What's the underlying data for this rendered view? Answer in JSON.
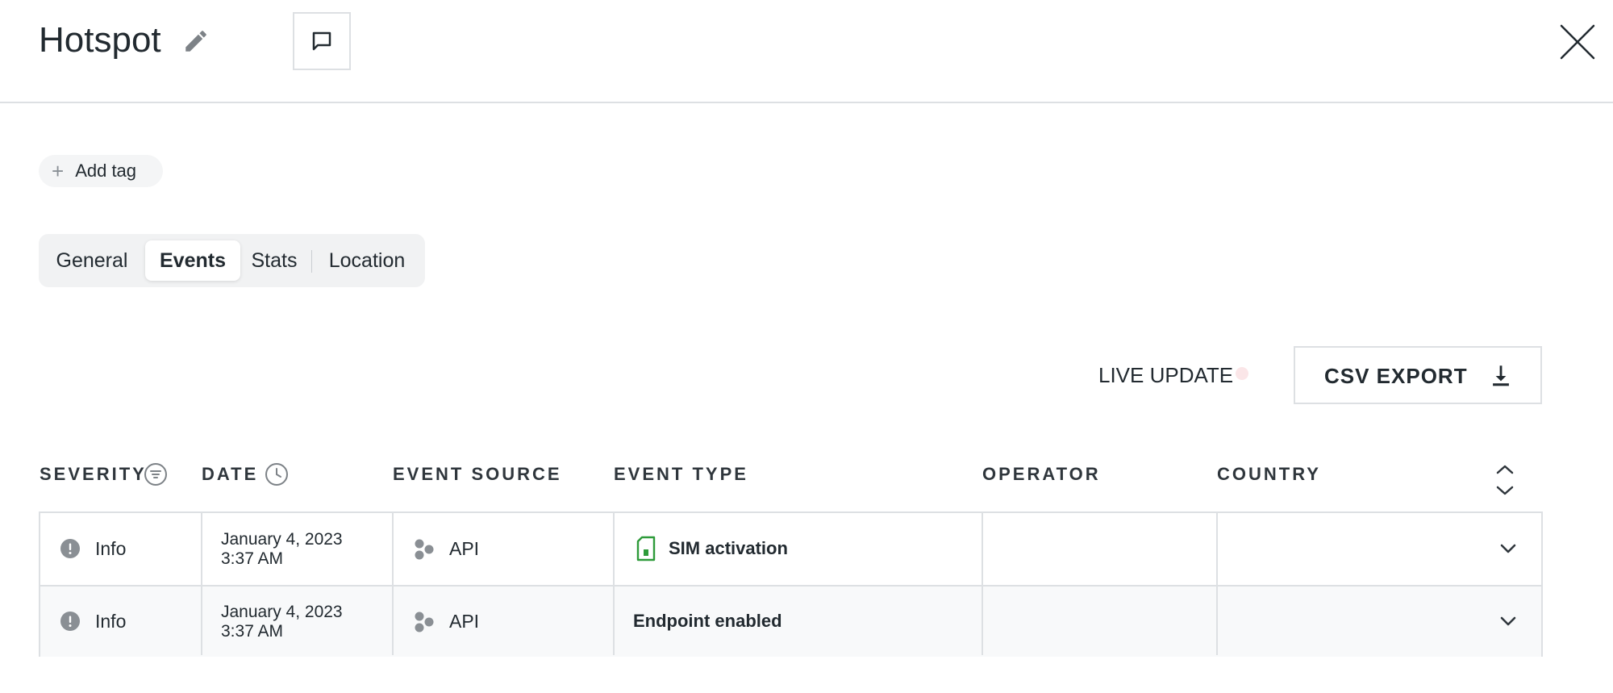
{
  "header": {
    "title": "Hotspot",
    "edit_icon": "pencil-icon",
    "comment_icon": "comment-icon",
    "close_icon": "close-icon"
  },
  "tags": {
    "add_label": "Add tag",
    "add_icon": "plus"
  },
  "tabs": [
    {
      "label": "General",
      "active": false
    },
    {
      "label": "Events",
      "active": true
    },
    {
      "label": "Stats",
      "active": false
    },
    {
      "label": "Location",
      "active": false
    }
  ],
  "toolbar": {
    "live_update_label": "LIVE UPDATE",
    "live_update_dot_color": "#fbe6e8",
    "csv_export_label": "CSV EXPORT",
    "csv_export_icon": "download-icon"
  },
  "table": {
    "columns": [
      {
        "label": "SEVERITY",
        "icon": "filter-icon"
      },
      {
        "label": "DATE",
        "icon": "clock-icon"
      },
      {
        "label": "EVENT SOURCE"
      },
      {
        "label": "EVENT TYPE"
      },
      {
        "label": "OPERATOR"
      },
      {
        "label": "COUNTRY"
      }
    ],
    "rows": [
      {
        "severity": "Info",
        "date_line1": "January 4, 2023",
        "date_line2": "3:37 AM",
        "event_source": "API",
        "event_type": "SIM activation",
        "event_type_icon": "sim-card-icon",
        "operator": "",
        "country": ""
      },
      {
        "severity": "Info",
        "date_line1": "January 4, 2023",
        "date_line2": "3:37 AM",
        "event_source": "API",
        "event_type": "Endpoint enabled",
        "operator": "",
        "country": ""
      }
    ]
  },
  "colors": {
    "text": "#222a30",
    "border": "#dde0e3",
    "sim_icon": "#2e9b3a",
    "severity_icon": "#8a8f94"
  }
}
